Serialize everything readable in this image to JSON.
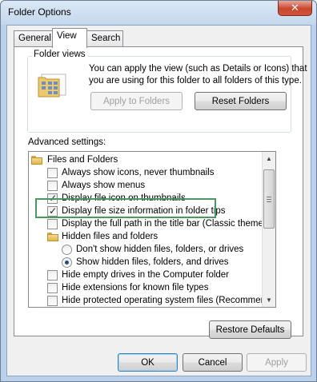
{
  "window": {
    "title": "Folder Options",
    "close_symbol": "✕"
  },
  "tabs": [
    {
      "label": "General"
    },
    {
      "label": "View"
    },
    {
      "label": "Search"
    }
  ],
  "folder_views": {
    "legend": "Folder views",
    "description_line1": "You can apply the view (such as Details or Icons) that",
    "description_line2": "you are using for this folder to all folders of this type.",
    "apply_button": "Apply to Folders",
    "reset_button": "Reset Folders"
  },
  "advanced": {
    "label": "Advanced settings:",
    "items": [
      {
        "type": "folder",
        "label": "Files and Folders"
      },
      {
        "type": "checkbox",
        "checked": false,
        "label": "Always show icons, never thumbnails"
      },
      {
        "type": "checkbox",
        "checked": false,
        "label": "Always show menus"
      },
      {
        "type": "checkbox",
        "checked": true,
        "label": "Display file icon on thumbnails"
      },
      {
        "type": "checkbox",
        "checked": true,
        "label": "Display file size information in folder tips"
      },
      {
        "type": "checkbox",
        "checked": false,
        "label": "Display the full path in the title bar (Classic theme only)"
      },
      {
        "type": "folder",
        "label": "Hidden files and folders"
      },
      {
        "type": "radio",
        "checked": false,
        "label": "Don't show hidden files, folders, or drives"
      },
      {
        "type": "radio",
        "checked": true,
        "label": "Show hidden files, folders, and drives"
      },
      {
        "type": "checkbox",
        "checked": false,
        "label": "Hide empty drives in the Computer folder"
      },
      {
        "type": "checkbox",
        "checked": false,
        "label": "Hide extensions for known file types"
      },
      {
        "type": "checkbox",
        "checked": false,
        "label": "Hide protected operating system files (Recommended)"
      }
    ],
    "checkmark": "✓",
    "scroll_up": "▲",
    "scroll_down": "▼"
  },
  "restore_button": "Restore Defaults",
  "footer": {
    "ok": "OK",
    "cancel": "Cancel",
    "apply": "Apply"
  },
  "colors": {
    "highlight_border": "#4a9960"
  }
}
